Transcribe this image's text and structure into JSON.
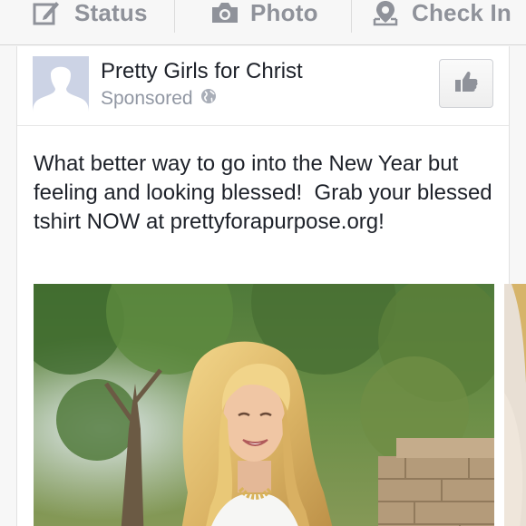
{
  "composer": {
    "status_label": "Status",
    "photo_label": "Photo",
    "checkin_label": "Check In",
    "icons": [
      "edit-icon",
      "camera-icon",
      "location-pin-icon"
    ]
  },
  "story": {
    "page_name": "Pretty Girls for Christ",
    "sponsored_label": "Sponsored",
    "audience_icon": "globe-icon",
    "like_icon": "thumbs-up-icon",
    "text": "What better way to go into the New Year but feeling and looking blessed!  Grab your blessed tshirt NOW at prettyforapurpose.org!"
  },
  "colors": {
    "composer_text": "#8f929a",
    "name_text": "#1d2129",
    "meta_text": "#9197a3",
    "avatar_bg": "#ccd3e5"
  }
}
